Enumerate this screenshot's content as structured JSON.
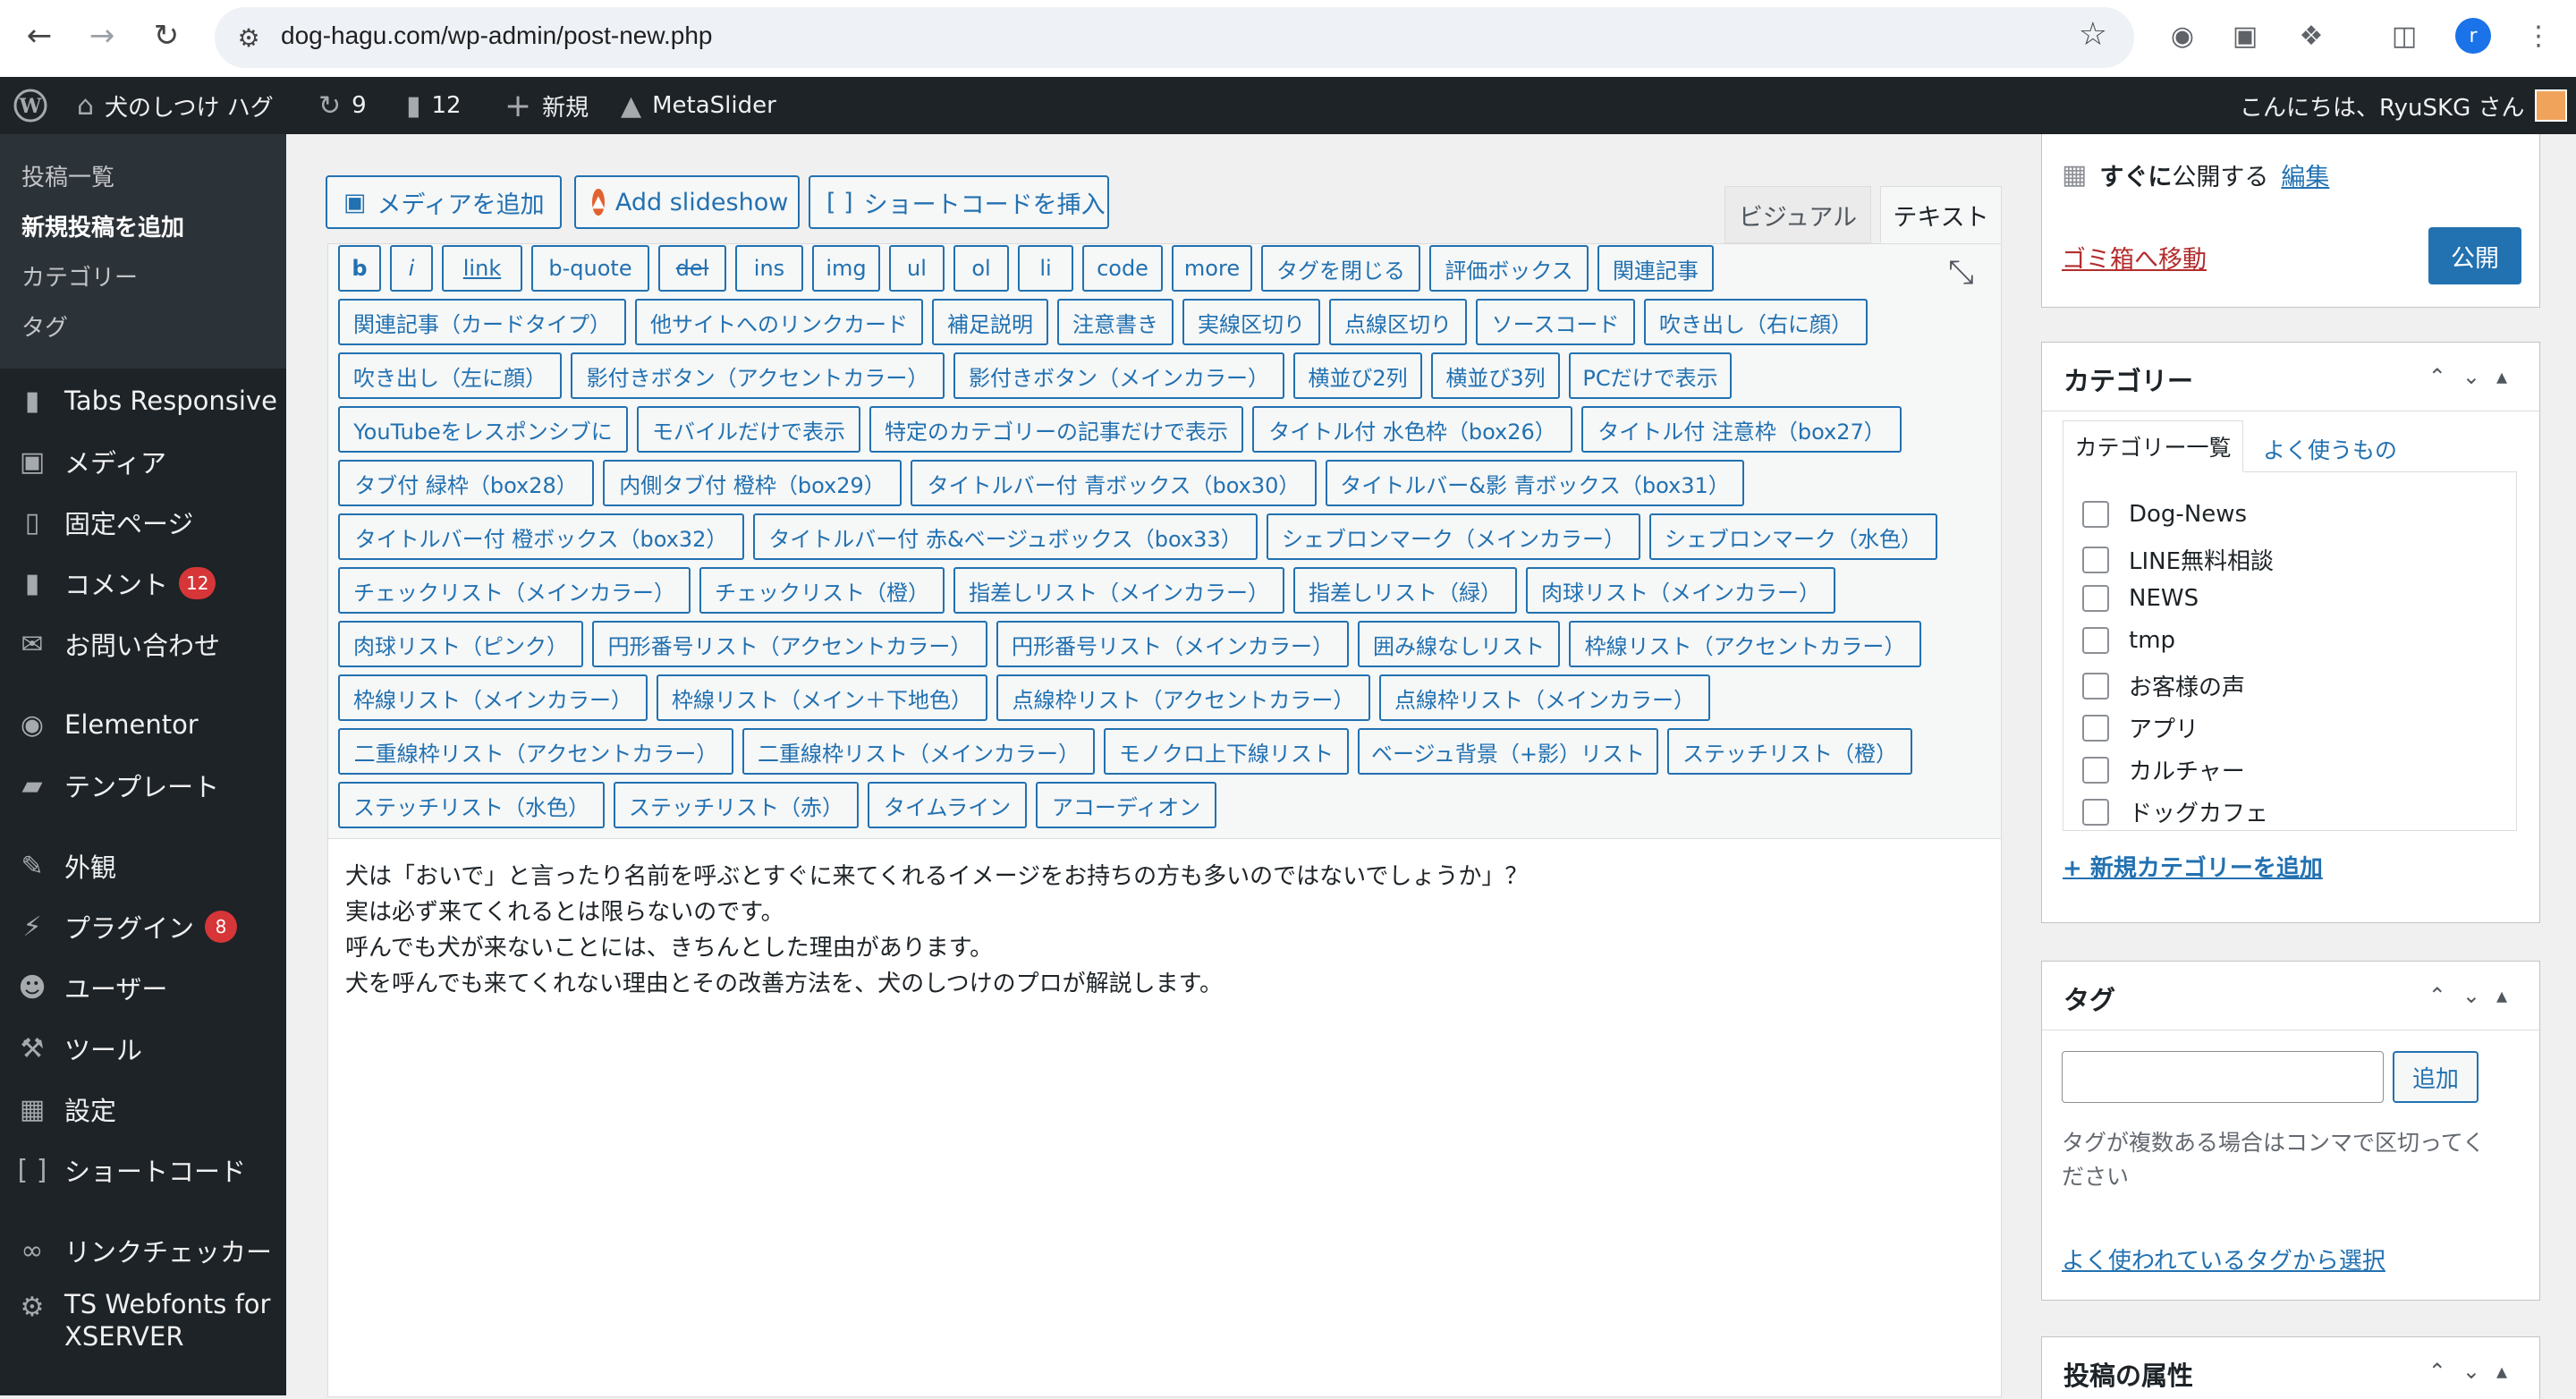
{
  "browser": {
    "url": "dog-hagu.com/wp-admin/post-new.php",
    "profile_initial": "r",
    "icons": [
      "back-arrow-icon",
      "forward-arrow-icon",
      "reload-icon",
      "site-info-icon",
      "star-icon",
      "camera-icon",
      "image-icon",
      "extensions-icon",
      "sidebar-icon"
    ]
  },
  "adminbar": {
    "site_name": "犬のしつけ ハグ",
    "updates_count": "9",
    "comments_count": "12",
    "new_label": "新規",
    "metaslider_label": "MetaSlider",
    "greeting": "こんにちは、RyuSKG さん"
  },
  "sidebar": {
    "submenu": [
      "投稿一覧",
      "新規投稿を追加",
      "カテゴリー",
      "タグ"
    ],
    "items": [
      {
        "label": "Tabs Responsive",
        "icon": "folder-icon"
      },
      {
        "label": "メディア",
        "icon": "media-icon"
      },
      {
        "label": "固定ページ",
        "icon": "page-icon"
      },
      {
        "label": "コメント",
        "icon": "comment-icon",
        "badge": "12"
      },
      {
        "label": "お問い合わせ",
        "icon": "mail-icon"
      },
      {
        "label": "Elementor",
        "icon": "elementor-icon"
      },
      {
        "label": "テンプレート",
        "icon": "folder-open-icon"
      },
      {
        "label": "外観",
        "icon": "brush-icon"
      },
      {
        "label": "プラグイン",
        "icon": "plugin-icon",
        "badge": "8"
      },
      {
        "label": "ユーザー",
        "icon": "user-icon"
      },
      {
        "label": "ツール",
        "icon": "wrench-icon"
      },
      {
        "label": "設定",
        "icon": "settings-icon"
      },
      {
        "label": "ショートコード",
        "icon": "shortcode-icon"
      },
      {
        "label": "リンクチェッカー",
        "icon": "link-checker-icon"
      },
      {
        "label": "TS Webfonts for",
        "label2": "XSERVER",
        "icon": "gear-icon"
      }
    ]
  },
  "editor": {
    "media_buttons": [
      "メディアを追加",
      "Add slideshow",
      "ショートコードを挿入"
    ],
    "tabs": [
      "ビジュアル",
      "テキスト"
    ],
    "quicktags": [
      [
        "b",
        "i",
        "link",
        "b-quote",
        "del",
        "ins",
        "img",
        "ul",
        "ol",
        "li",
        "code",
        "more",
        "タグを閉じる",
        "評価ボックス",
        "関連記事"
      ],
      [
        "関連記事（カードタイプ）",
        "他サイトへのリンクカード",
        "補足説明",
        "注意書き",
        "実線区切り",
        "点線区切り",
        "ソースコード",
        "吹き出し（右に顔）"
      ],
      [
        "吹き出し（左に顔）",
        "影付きボタン（アクセントカラー）",
        "影付きボタン（メインカラー）",
        "横並び2列",
        "横並び3列",
        "PCだけで表示"
      ],
      [
        "YouTubeをレスポンシブに",
        "モバイルだけで表示",
        "特定のカテゴリーの記事だけで表示",
        "タイトル付 水色枠（box26）",
        "タイトル付 注意枠（box27）"
      ],
      [
        "タブ付 緑枠（box28）",
        "内側タブ付 橙枠（box29）",
        "タイトルバー付 青ボックス（box30）",
        "タイトルバー&影 青ボックス（box31）"
      ],
      [
        "タイトルバー付 橙ボックス（box32）",
        "タイトルバー付 赤&ベージュボックス（box33）",
        "シェブロンマーク（メインカラー）",
        "シェブロンマーク（水色）"
      ],
      [
        "チェックリスト（メインカラー）",
        "チェックリスト（橙）",
        "指差しリスト（メインカラー）",
        "指差しリスト（緑）",
        "肉球リスト（メインカラー）"
      ],
      [
        "肉球リスト（ピンク）",
        "円形番号リスト（アクセントカラー）",
        "円形番号リスト（メインカラー）",
        "囲み線なしリスト",
        "枠線リスト（アクセントカラー）"
      ],
      [
        "枠線リスト（メインカラー）",
        "枠線リスト（メイン＋下地色）",
        "点線枠リスト（アクセントカラー）",
        "点線枠リスト（メインカラー）"
      ],
      [
        "二重線枠リスト（アクセントカラー）",
        "二重線枠リスト（メインカラー）",
        "モノクロ上下線リスト",
        "ベージュ背景（+影）リスト",
        "ステッチリスト（橙）"
      ],
      [
        "ステッチリスト（水色）",
        "ステッチリスト（赤）",
        "タイムライン",
        "アコーディオン"
      ]
    ],
    "content_lines": [
      "犬は「おいで」と言ったり名前を呼ぶとすぐに来てくれるイメージをお持ちの方も多いのではないでしょうか」？",
      "実は必ず来てくれるとは限らないのです。",
      "呼んでも犬が来ないことには、きちんとした理由があります。",
      "犬を呼んでも来てくれない理由とその改善方法を、犬のしつけのプロが解説します。"
    ]
  },
  "publish": {
    "schedule_bold": "すぐに",
    "schedule_rest": "公開する",
    "edit_link": "編集",
    "trash_link": "ゴミ箱へ移動",
    "publish_button": "公開"
  },
  "categories": {
    "title": "カテゴリー",
    "tab_all": "カテゴリー一覧",
    "tab_popular": "よく使うもの",
    "items": [
      "Dog-News",
      "LINE無料相談",
      "NEWS",
      "tmp",
      "お客様の声",
      "アプリ",
      "カルチャー",
      "ドッグカフェ"
    ],
    "add_link": "+ 新規カテゴリーを追加"
  },
  "tags": {
    "title": "タグ",
    "add_button": "追加",
    "help_text_1": "タグが複数ある場合はコンマで区切ってく",
    "help_text_2": "ださい",
    "popular_link": "よく使われているタグから選択"
  },
  "attributes": {
    "title": "投稿の属性"
  },
  "colors": {
    "accent": "#2271b1",
    "admin_dark": "#1d2327",
    "badge": "#d63638",
    "trash": "#b32d2e"
  }
}
